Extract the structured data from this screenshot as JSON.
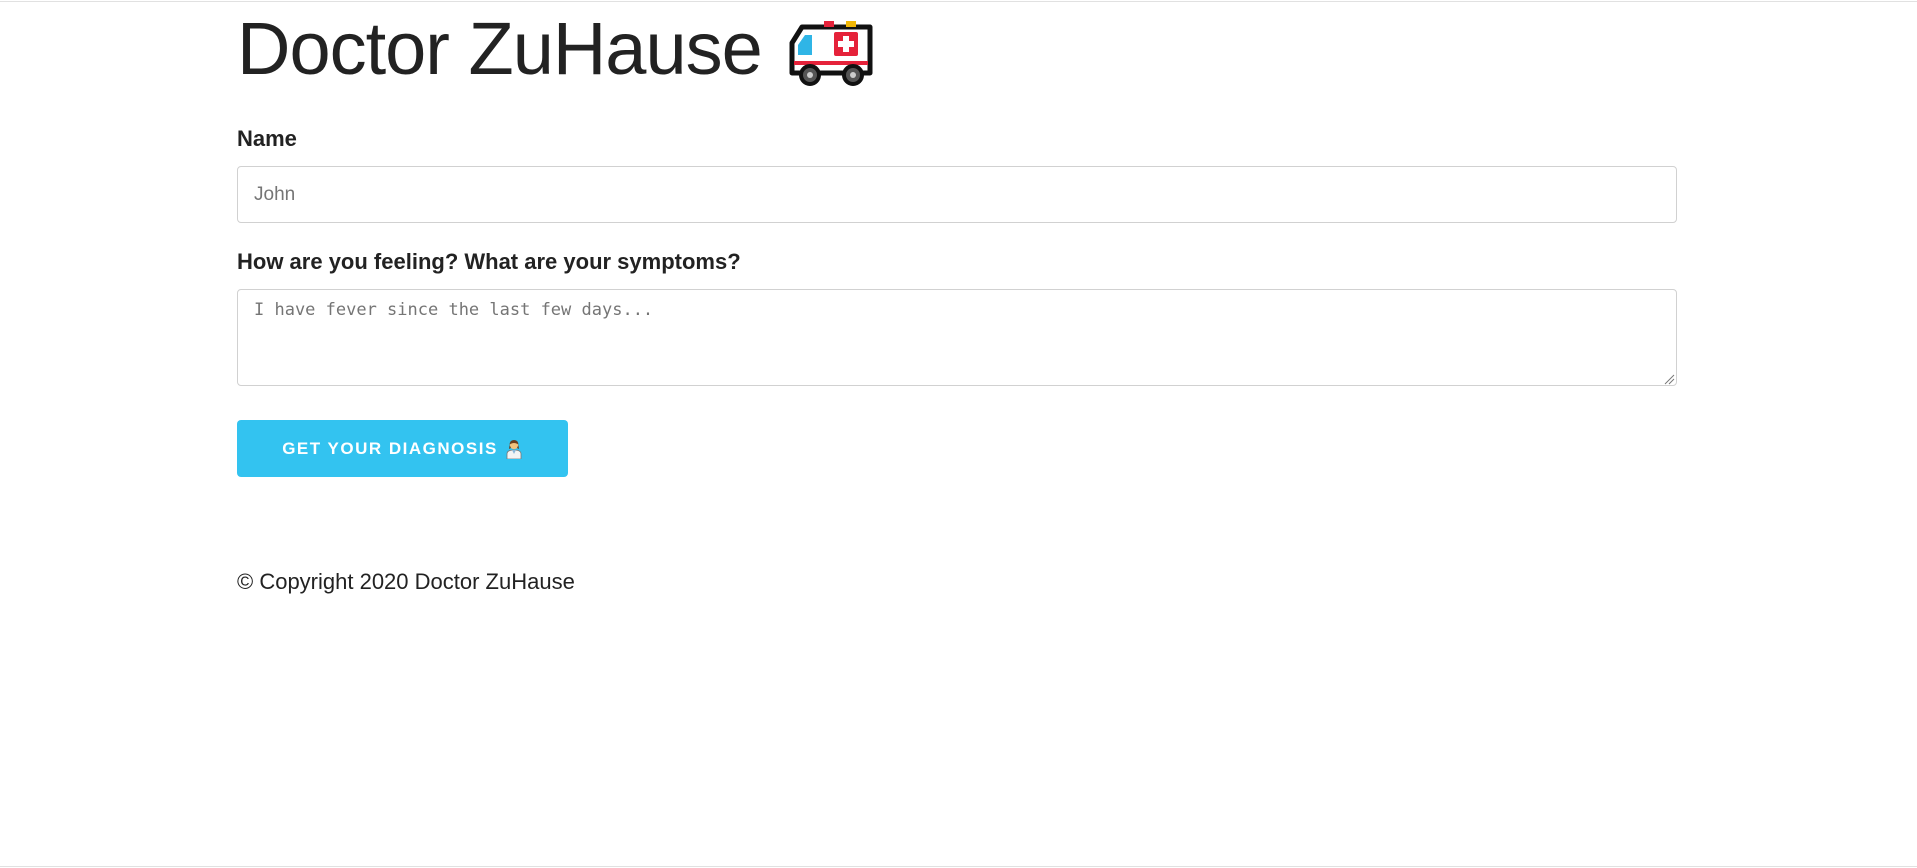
{
  "header": {
    "title": "Doctor ZuHause",
    "icon": "ambulance-icon"
  },
  "form": {
    "name_label": "Name",
    "name_placeholder": "John",
    "name_value": "",
    "symptoms_label": "How are you feeling? What are your symptoms?",
    "symptoms_placeholder": "I have fever since the last few days...",
    "symptoms_value": "",
    "submit_label": "Get your diagnosis",
    "submit_icon": "doctor-icon"
  },
  "footer": {
    "copyright": "© Copyright 2020 Doctor ZuHause"
  },
  "colors": {
    "accent": "#33c3f0",
    "text": "#222222",
    "border": "#d1d1d1"
  }
}
